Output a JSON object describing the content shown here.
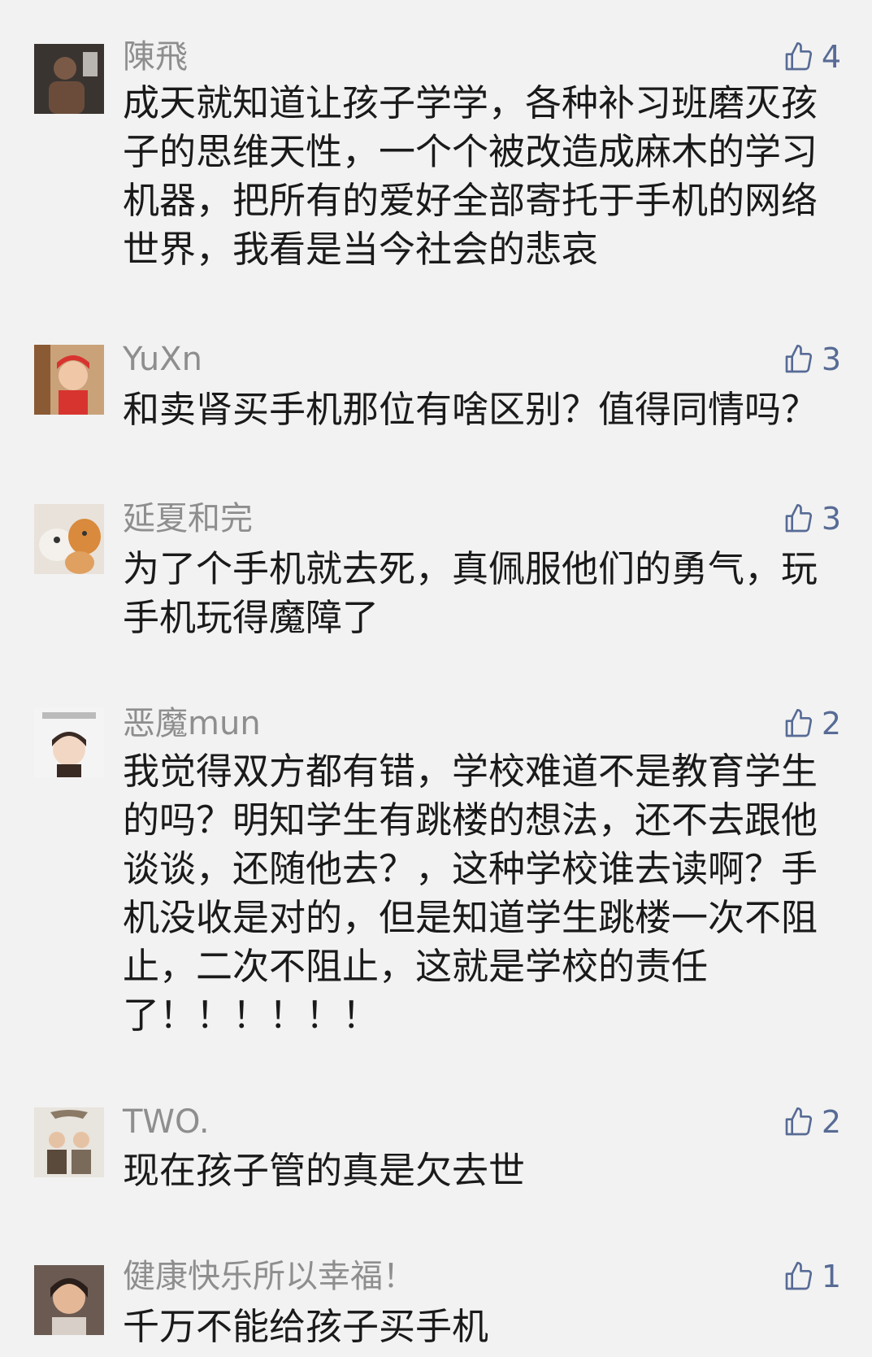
{
  "colors": {
    "background": "#f2f2f2",
    "username": "#8e8e8e",
    "like": "#576b95",
    "text": "#1a1a1a"
  },
  "comments": [
    {
      "username": "陳飛",
      "likes": "4",
      "avatar_icon": "user-avatar-icon",
      "text": "成天就知道让孩子学学，各种补习班磨灭孩\n子的思维天性，一个个被改造成麻木的学习\n机器，把所有的爱好全部寄托于手机的网络\n世界，我看是当今社会的悲哀"
    },
    {
      "username": "YuXn",
      "likes": "3",
      "avatar_icon": "user-avatar-icon",
      "text": "和卖肾买手机那位有啥区别？值得同情吗？"
    },
    {
      "username": "延夏和完",
      "likes": "3",
      "avatar_icon": "user-avatar-icon",
      "text": "为了个手机就去死，真佩服他们的勇气，玩\n手机玩得魔障了"
    },
    {
      "username": "恶魔mun",
      "likes": "2",
      "avatar_icon": "user-avatar-icon",
      "text": "我觉得双方都有错，学校难道不是教育学生\n的吗？明知学生有跳楼的想法，还不去跟他\n谈谈，还随他去？，这种学校谁去读啊？手\n机没收是对的，但是知道学生跳楼一次不阻\n止，二次不阻止，这就是学校的责任\n了！！！！！！"
    },
    {
      "username": "TWO.",
      "likes": "2",
      "avatar_icon": "user-avatar-icon",
      "text": "现在孩子管的真是欠去世"
    },
    {
      "username": "健康快乐所以幸福！",
      "likes": "1",
      "avatar_icon": "user-avatar-icon",
      "text": "千万不能给孩子买手机"
    }
  ]
}
